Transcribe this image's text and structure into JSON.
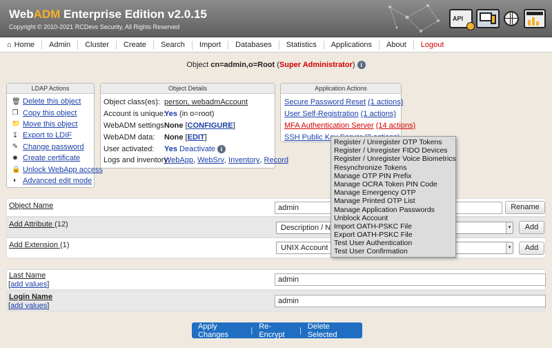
{
  "header": {
    "brand_prefix": "Web",
    "brand_adm": "ADM",
    "brand_suffix": " Enterprise Edition v2.0.15",
    "copyright": "Copyright © 2010-2021 RCDevs Security, All Rights Reserved",
    "api_label": "API"
  },
  "nav": [
    {
      "label": "Home",
      "icon": "home-icon"
    },
    {
      "label": "Admin"
    },
    {
      "label": "Cluster"
    },
    {
      "label": "Create"
    },
    {
      "label": "Search"
    },
    {
      "label": "Import"
    },
    {
      "label": "Databases"
    },
    {
      "label": "Statistics"
    },
    {
      "label": "Applications"
    },
    {
      "label": "About"
    },
    {
      "label": "Logout",
      "color": "#d20000"
    }
  ],
  "object": {
    "prefix": "Object",
    "dn": "cn=admin,o=Root",
    "role": "Super Administrator"
  },
  "ldap_actions": {
    "title": "LDAP Actions",
    "items": [
      {
        "label": "Delete this object",
        "icon": "trash-icon"
      },
      {
        "label": "Copy this object",
        "icon": "copy-icon"
      },
      {
        "label": "Move this object",
        "icon": "folder-icon"
      },
      {
        "label": "Export to LDIF",
        "icon": "download-icon"
      },
      {
        "label": "Change password",
        "icon": "pencil-icon"
      },
      {
        "label": "Create certificate",
        "icon": "certificate-icon"
      },
      {
        "label": "Unlock WebApp access",
        "icon": "lock-icon"
      },
      {
        "label": "Advanced edit mode",
        "icon": "toggle-icon"
      }
    ]
  },
  "object_details": {
    "title": "Object Details",
    "classes_label": "Object class(es):",
    "classes_value": "person, webadmAccount",
    "unique_label": "Account is unique:",
    "unique_yes": "Yes",
    "unique_scope": "(in o=root)",
    "settings_label": "WebADM settings:",
    "settings_none": "None",
    "settings_link": "CONFIGURE",
    "data_label": "WebADM data:",
    "data_none": "None",
    "data_link": "EDIT",
    "activated_label": "User activated:",
    "activated_yes": "Yes",
    "activated_link": "Deactivate",
    "logs_label": "Logs and inventory:",
    "logs_links": [
      "WebApp",
      "WebSrv",
      "Inventory",
      "Record"
    ]
  },
  "app_actions": {
    "title": "Application Actions",
    "items": [
      {
        "label": "Secure Password Reset",
        "count": "(1 actions)"
      },
      {
        "label": "User Self-Registration",
        "count": "(1 actions)"
      },
      {
        "label": "MFA Authentication Server",
        "count": "(14 actions)",
        "highlight": true
      },
      {
        "label": "SSH Public Key Server",
        "count": "(3 actions)"
      }
    ]
  },
  "mfa_menu": [
    "Register / Unregister OTP Tokens",
    "Register / Unregister FIDO Devices",
    "Register / Unregister Voice Biometrics",
    "Resynchronize Tokens",
    "Manage OTP PIN Prefix",
    "Manage OCRA Token PIN Code",
    "Manage Emergency OTP",
    "Manage Printed OTP List",
    "Manage Application Passwords",
    "Unblock Account",
    "Import OATH-PSKC File",
    "Export OATH-PSKC File",
    "Test User Authentication",
    "Test User Confirmation"
  ],
  "form": {
    "object_name_label": "Object Name",
    "object_name_value": "admin",
    "rename_label": "Rename",
    "add_attribute_label": "Add Attribute",
    "add_attribute_count": "(12)",
    "add_attribute_selected": "Description / No",
    "add_label": "Add",
    "add_extension_label": "Add Extension",
    "add_extension_count": "(1)",
    "add_extension_selected": "UNIX Account",
    "last_name_label": "Last Name",
    "last_name_value": "admin",
    "login_name_label": "Login Name",
    "login_name_value": "admin",
    "add_values_label": "add values"
  },
  "actions": {
    "apply": "Apply Changes",
    "reencrypt": "Re-Encrypt",
    "delete": "Delete Selected"
  },
  "colors": {
    "accent": "#1f6ec2",
    "brand": "#f3b12a",
    "danger": "#d20000",
    "link": "#1a3ea8"
  }
}
